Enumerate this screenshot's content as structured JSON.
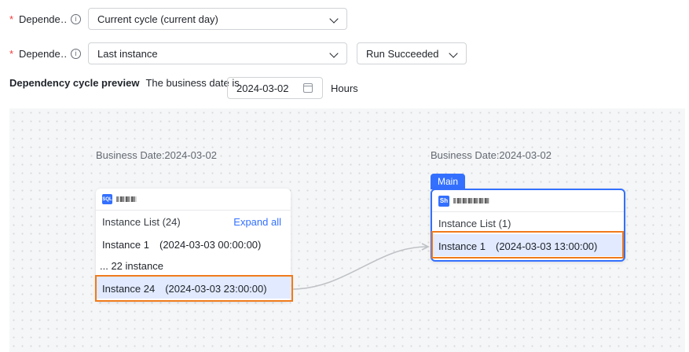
{
  "form": {
    "row1": {
      "required_mark": "*",
      "label": "Depende…",
      "info_icon": "info-circle-icon",
      "value": "Current cycle (current day)"
    },
    "row2": {
      "required_mark": "*",
      "label": "Depende…",
      "info_icon": "info-circle-icon",
      "value": "Last instance",
      "status_value": "Run Succeeded"
    }
  },
  "preview": {
    "title": "Dependency cycle preview",
    "desc": "The business date is",
    "date": "2024-03-02",
    "calendar_icon": "calendar-icon",
    "unit": "Hours"
  },
  "canvas": {
    "upstream": {
      "business_date": "Business Date:2024-03-02",
      "type": "SQL",
      "list_title": "Instance List (24)",
      "expand_label": "Expand all",
      "instances": [
        "Instance 1　(2024-03-03 00:00:00)",
        "... 22 instance",
        "Instance 24　(2024-03-03 23:00:00)"
      ]
    },
    "main": {
      "business_date": "Business Date:2024-03-02",
      "tag": "Main",
      "type": "Sh",
      "list_title": "Instance List (1)",
      "instances": [
        "Instance 1　(2024-03-03 13:00:00)"
      ]
    }
  },
  "colors": {
    "accent": "#3370ff",
    "highlight_border": "#f07b1c",
    "required": "#f23a3a"
  }
}
